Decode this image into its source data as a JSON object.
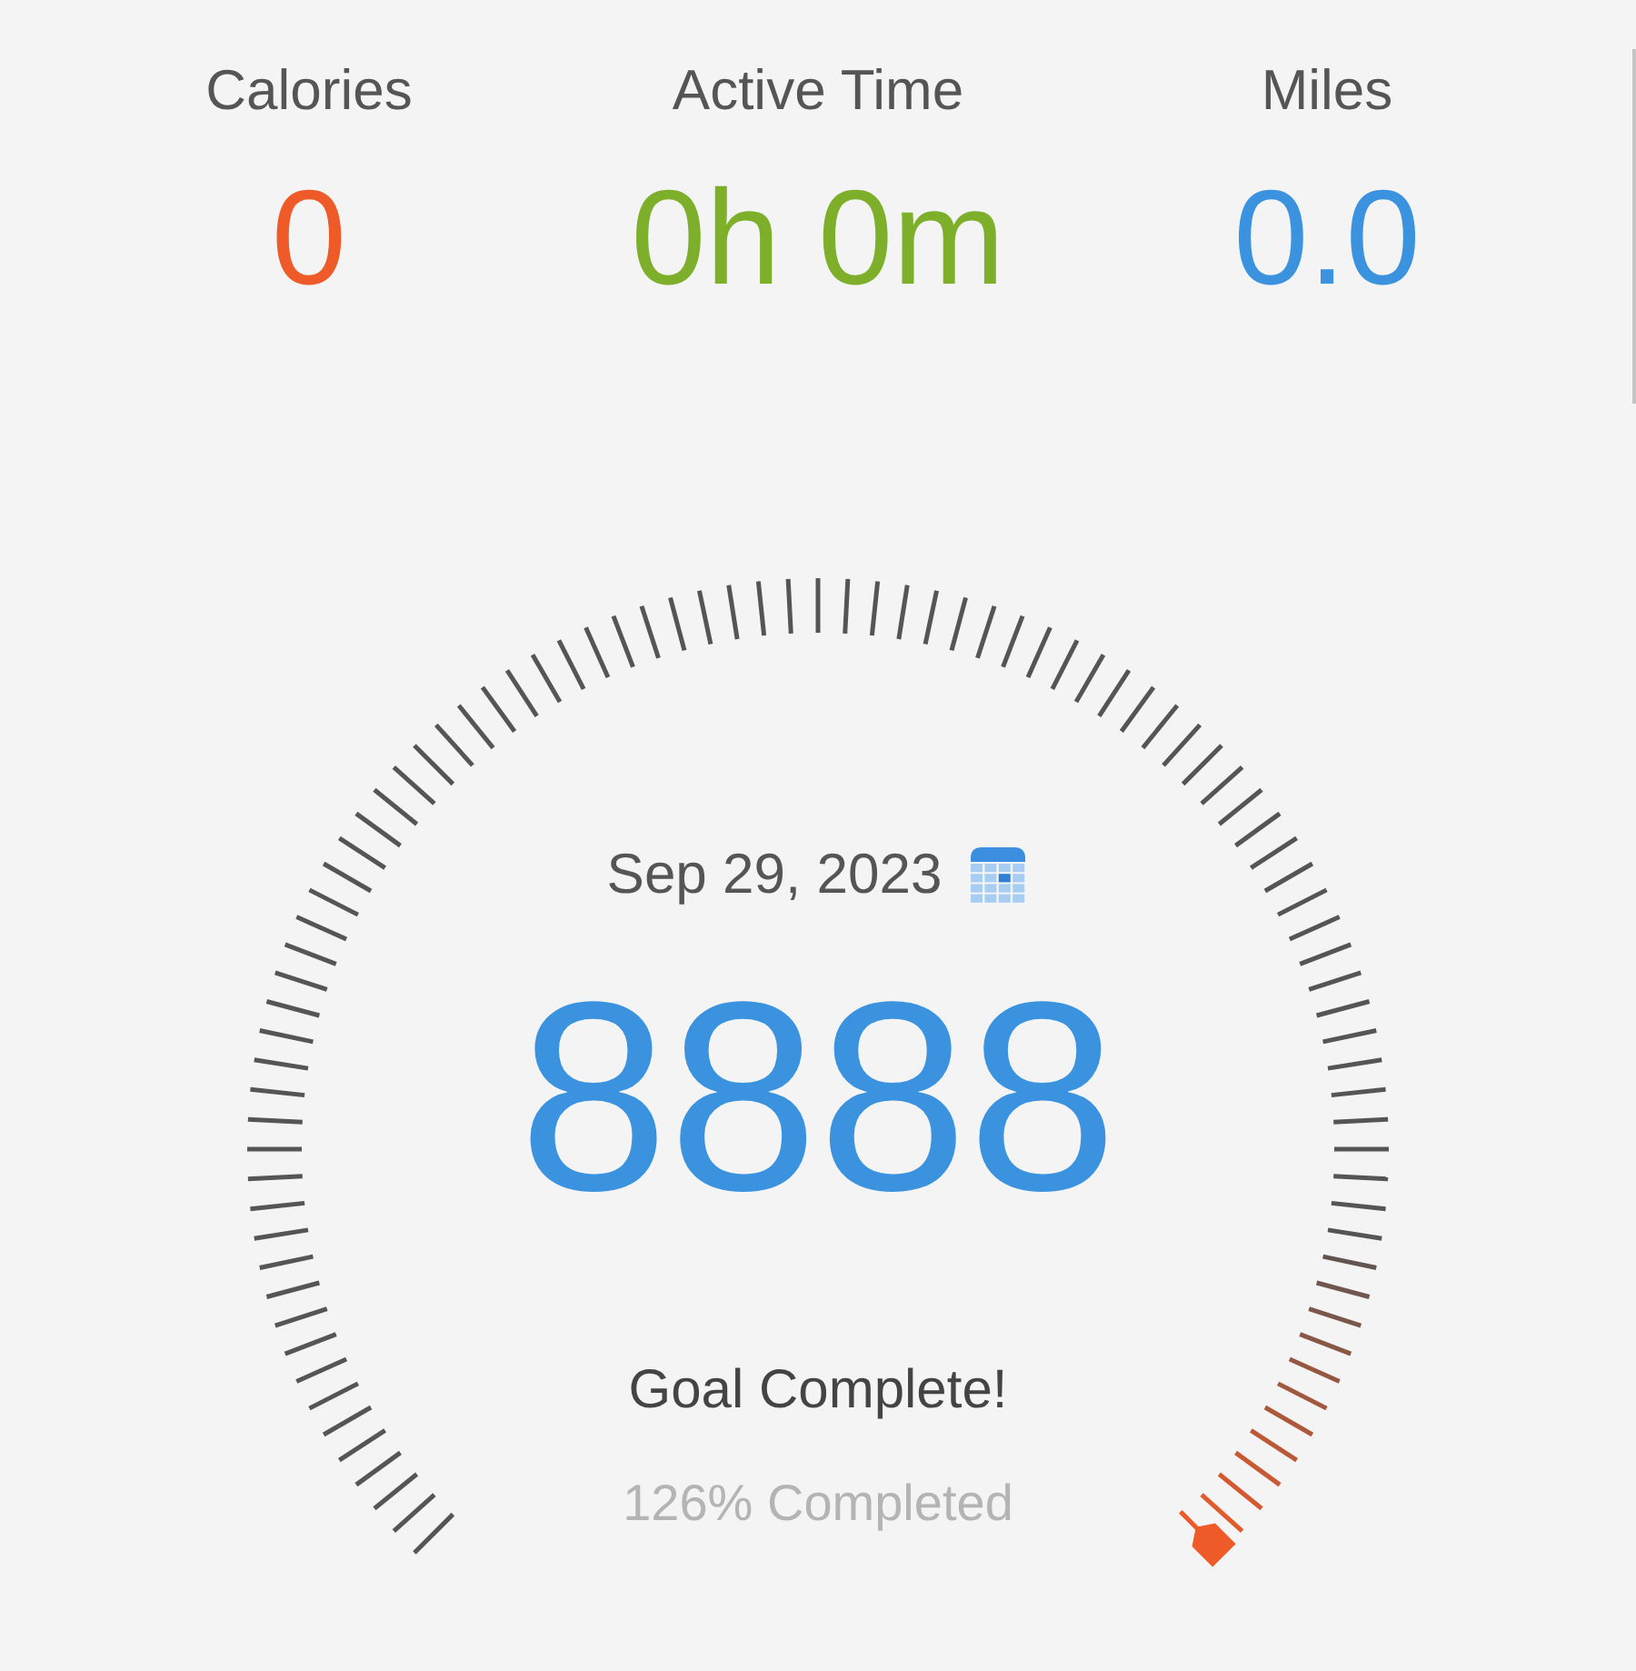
{
  "stats": [
    {
      "label": "Calories",
      "value": "0",
      "color": "#ee5a28"
    },
    {
      "label": "Active Time",
      "value": "0h 0m",
      "color": "#7eaf2b"
    },
    {
      "label": "Miles",
      "value": "0.0",
      "color": "#3b93e0"
    }
  ],
  "gauge": {
    "date": "Sep 29, 2023",
    "steps": "8888",
    "status": "Goal Complete!",
    "percent": "126% Completed"
  }
}
